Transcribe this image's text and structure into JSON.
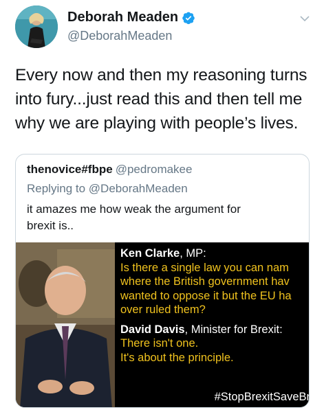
{
  "tweet": {
    "author_name": "Deborah Meaden",
    "author_handle": "@DeborahMeaden",
    "verified": true,
    "text": "Every now and then my reasoning turns\ninto fury...just read this and then tell me\nwhy we are playing with people’s lives."
  },
  "quote": {
    "author_name": "thenovice#fbpe",
    "author_handle": "@pedromakee",
    "replying_prefix": "Replying to",
    "replying_to": "@DeborahMeaden",
    "text": "it amazes me how weak the argument for\nbrexit is..",
    "image": {
      "speaker1_name": "Ken Clarke",
      "speaker1_role": ", MP:",
      "speaker1_lines": [
        "Is there a single law you can nam",
        "where the British government hav",
        "wanted to oppose it but the EU ha",
        "over ruled them?"
      ],
      "speaker2_name": "David Davis",
      "speaker2_role": ", Minister for Brexit:",
      "speaker2_lines": [
        "There isn't one.",
        "It's about the principle."
      ],
      "hashtag": "#StopBrexitSaveBr",
      "text_color": "#f0c21e"
    }
  },
  "colors": {
    "verified_blue": "#1da1f2",
    "secondary_text": "#657786",
    "border": "#ccd6dd"
  },
  "icons": [
    "verified-badge-icon",
    "chevron-down-icon"
  ]
}
